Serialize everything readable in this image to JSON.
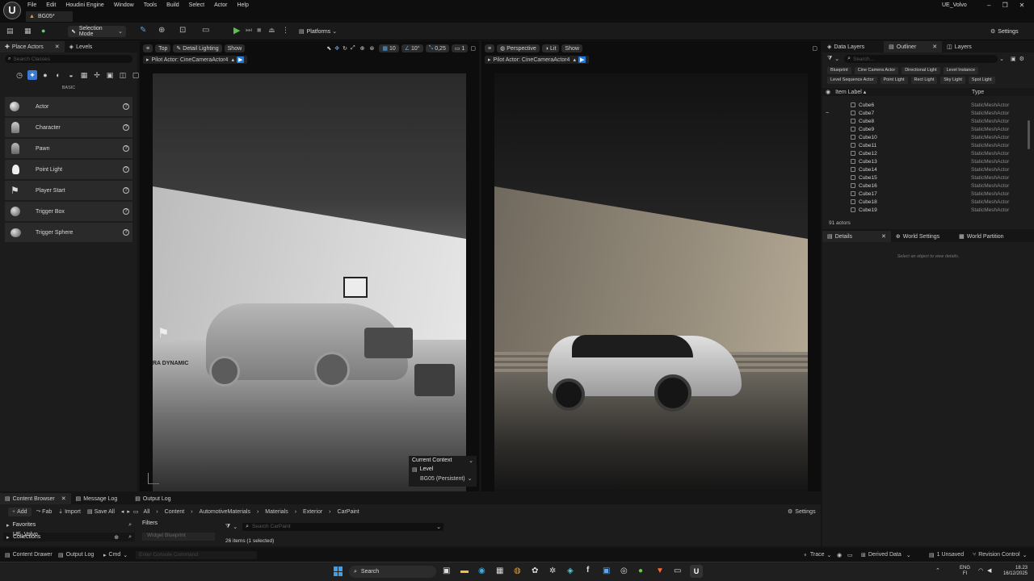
{
  "window": {
    "project_name": "UE_Volvo",
    "level_tab": "BG05*"
  },
  "menu": [
    "File",
    "Edit",
    "Houdini Engine",
    "Window",
    "Tools",
    "Build",
    "Select",
    "Actor",
    "Help"
  ],
  "toolbar": {
    "mode": "Selection Mode",
    "platforms": "Platforms",
    "settings": "Settings"
  },
  "left_tabs": {
    "place_actors": "Place Actors",
    "levels": "Levels"
  },
  "place": {
    "search_placeholder": "Search Classes",
    "category": "BASIC",
    "actors": [
      "Actor",
      "Character",
      "Pawn",
      "Point Light",
      "Player Start",
      "Trigger Box",
      "Trigger Sphere"
    ]
  },
  "viewport_left": {
    "view": "Top",
    "lighting": "Detail Lighting",
    "show": "Show",
    "pilot": "Pilot Actor: CineCameraActor4",
    "grid": "10",
    "angle": "10°",
    "scale": "0,25",
    "cams": "1",
    "context_title": "Current Context",
    "context_level_label": "Level",
    "context_level": "BG05 (Persistent)",
    "brand_text": "RA DYNAMIC"
  },
  "viewport_right": {
    "view": "Perspective",
    "lighting": "Lit",
    "show": "Show",
    "pilot": "Pilot Actor: CineCameraActor4"
  },
  "right_tabs": {
    "data_layers": "Data Layers",
    "outliner": "Outliner",
    "layers": "Layers"
  },
  "outliner": {
    "search_placeholder": "Search...",
    "filters": [
      [
        "Blueprint",
        "Cine Camera Actor",
        "Directional Light",
        "Level Instance"
      ],
      [
        "Level Sequence Actor",
        "Point Light",
        "Rect Light",
        "Sky Light",
        "Spot Light"
      ]
    ],
    "col_label": "Item Label",
    "col_type": "Type",
    "rows": [
      {
        "name": "Cube6",
        "type": "StaticMeshActor"
      },
      {
        "name": "Cube7",
        "type": "StaticMeshActor"
      },
      {
        "name": "Cube8",
        "type": "StaticMeshActor"
      },
      {
        "name": "Cube9",
        "type": "StaticMeshActor"
      },
      {
        "name": "Cube10",
        "type": "StaticMeshActor"
      },
      {
        "name": "Cube11",
        "type": "StaticMeshActor"
      },
      {
        "name": "Cube12",
        "type": "StaticMeshActor"
      },
      {
        "name": "Cube13",
        "type": "StaticMeshActor"
      },
      {
        "name": "Cube14",
        "type": "StaticMeshActor"
      },
      {
        "name": "Cube15",
        "type": "StaticMeshActor"
      },
      {
        "name": "Cube16",
        "type": "StaticMeshActor"
      },
      {
        "name": "Cube17",
        "type": "StaticMeshActor"
      },
      {
        "name": "Cube18",
        "type": "StaticMeshActor"
      },
      {
        "name": "Cube19",
        "type": "StaticMeshActor"
      }
    ],
    "count": "91 actors"
  },
  "details_tabs": {
    "details": "Details",
    "world_settings": "World Settings",
    "world_partition": "World Partition"
  },
  "details_empty": "Select an object to view details.",
  "bottom_tabs": {
    "content_browser": "Content Browser",
    "message_log": "Message Log",
    "output_log": "Output Log"
  },
  "content": {
    "add": "Add",
    "fab": "Fab",
    "import": "Import",
    "save_all": "Save All",
    "path": [
      "All",
      "Content",
      "AutomotiveMaterials",
      "Materials",
      "Exterior",
      "CarPaint"
    ],
    "settings": "Settings",
    "favorites": "Favorites",
    "project": "UE_Volvo",
    "collections": "Collections",
    "filters": "Filters",
    "filter_item": "Widget Blueprint",
    "search_placeholder": "Search CarPaint",
    "items_count": "26 items (1 selected)"
  },
  "statusbar": {
    "content_drawer": "Content Drawer",
    "output_log": "Output Log",
    "cmd": "Cmd",
    "console_placeholder": "Enter Console Command",
    "trace": "Trace",
    "derived_data": "Derived Data",
    "unsaved": "1 Unsaved",
    "revision": "Revision Control"
  },
  "taskbar": {
    "search": "Search",
    "lang": "ENG",
    "region": "FI",
    "time": "18.23",
    "date": "16/12/2025"
  }
}
